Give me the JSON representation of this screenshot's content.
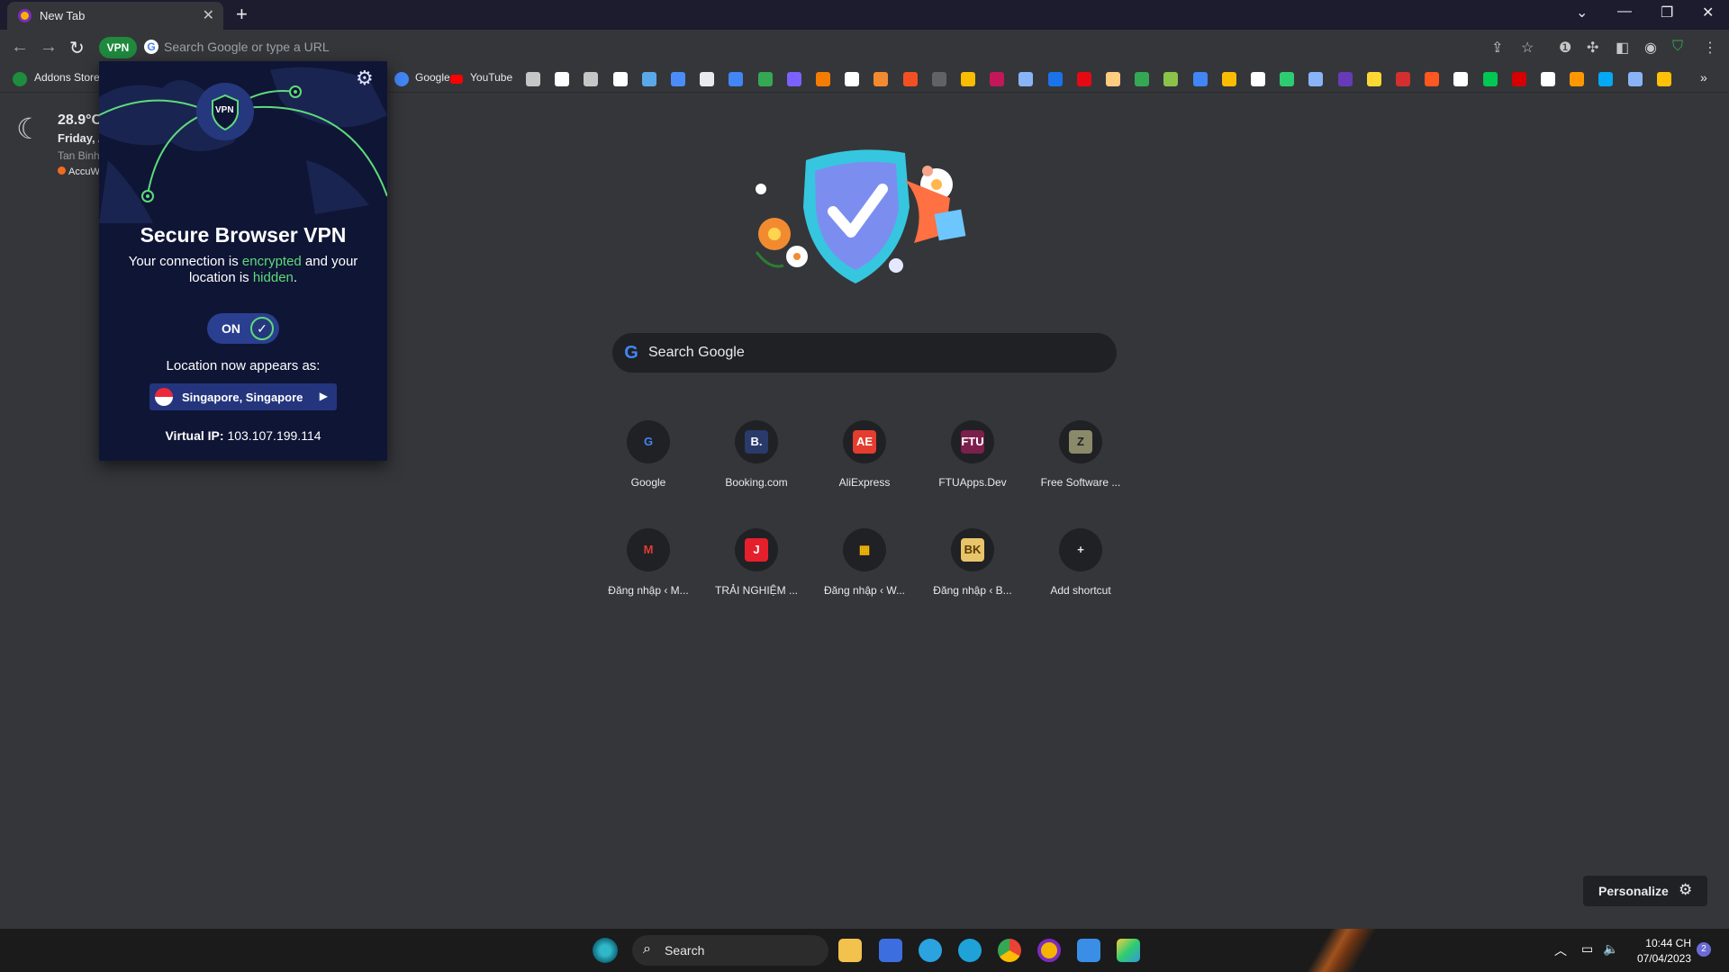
{
  "browser": {
    "tab_title": "New Tab",
    "omnibox_placeholder": "Search Google or type a URL",
    "vpn_badge": "VPN"
  },
  "bookmarks": {
    "items": [
      {
        "label": "Addons Store",
        "icon": "addons-store-icon"
      },
      {
        "label": "Google",
        "icon": "google-icon"
      },
      {
        "label": "YouTube",
        "icon": "youtube-icon"
      }
    ],
    "extra_icon_colors": [
      "#c4c7c5",
      "#ffffff",
      "#c4c7c5",
      "#ffffff",
      "#5aa9e6",
      "#4b8df8",
      "#e8eaed",
      "#4285f4",
      "#34a853",
      "#7b61ff",
      "#f57c00",
      "#ffffff",
      "#f28b30",
      "#f25022",
      "#5f6368",
      "#fbbc04",
      "#c2185b",
      "#8ab4f8",
      "#1a73e8",
      "#e50914",
      "#ffcc80",
      "#34a853",
      "#8bc34a",
      "#4285f4",
      "#fbbc04",
      "#ffffff",
      "#2ecc71",
      "#8ab4f8",
      "#673ab7",
      "#fdd835",
      "#d32f2f",
      "#ff5722",
      "#ffffff",
      "#00c853",
      "#d50000",
      "#ffffff",
      "#ff9800",
      "#03a9f4",
      "#8ab4f8",
      "#ffc107"
    ]
  },
  "weather": {
    "temp": "28.9°C",
    "day": "Friday, A",
    "place": "Tan Binh",
    "source": "AccuW"
  },
  "vpn": {
    "badge": "VPN",
    "title": "Secure Browser VPN",
    "desc_1": "Your connection is ",
    "desc_encrypted": "encrypted",
    "desc_2": " and your location is ",
    "desc_hidden": "hidden",
    "desc_3": ".",
    "toggle": "ON",
    "location_label": "Location now appears as:",
    "location": "Singapore, Singapore",
    "ip_label": "Virtual IP:",
    "ip_value": " 103.107.199.114"
  },
  "search": {
    "placeholder": "Search Google"
  },
  "shortcuts": [
    {
      "label": "Google",
      "glyph": "G",
      "color": "#4285f4",
      "bg": "#202124"
    },
    {
      "label": "Booking.com",
      "glyph": "B.",
      "color": "#ffffff",
      "bg": "#2a3a6b"
    },
    {
      "label": "AliExpress",
      "glyph": "AE",
      "color": "#ffffff",
      "bg": "#e43d2f"
    },
    {
      "label": "FTUApps.Dev",
      "glyph": "FTU",
      "color": "#ffffff",
      "bg": "#7b1f4d"
    },
    {
      "label": "Free Software ...",
      "glyph": "Z",
      "color": "#202124",
      "bg": "#8a8a6a"
    },
    {
      "label": "Đăng nhập ‹ M...",
      "glyph": "M",
      "color": "#e53935",
      "bg": "#202124"
    },
    {
      "label": "TRẢI NGHIỆM ...",
      "glyph": "J",
      "color": "#ffffff",
      "bg": "#e5202c"
    },
    {
      "label": "Đăng nhập ‹ W...",
      "glyph": "▦",
      "color": "#fbbc04",
      "bg": "#202124"
    },
    {
      "label": "Đăng nhập ‹ B...",
      "glyph": "BK",
      "color": "#5a3c00",
      "bg": "#e8c46a"
    },
    {
      "label": "Add shortcut",
      "glyph": "+",
      "color": "#e8eaed",
      "bg": "#202124"
    }
  ],
  "personalize": {
    "label": "Personalize"
  },
  "taskbar": {
    "search": "Search",
    "time": "10:44 CH",
    "date": "07/04/2023",
    "notifications": "2"
  }
}
